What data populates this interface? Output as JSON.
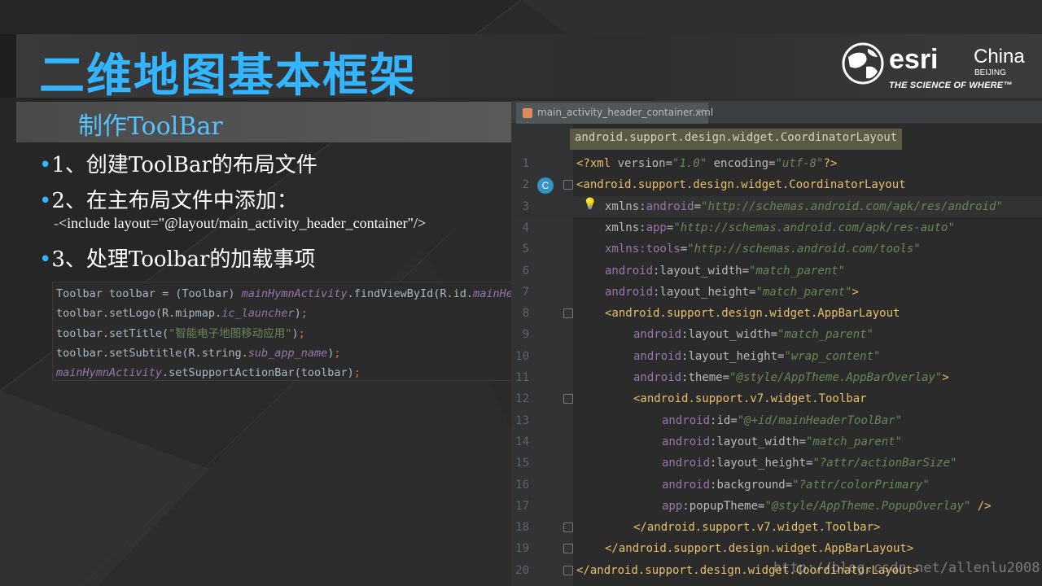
{
  "slide": {
    "title": "二维地图基本框架",
    "subtitle": "制作ToolBar",
    "bullets": [
      {
        "dot": "•",
        "text": "1、创建ToolBar的布局文件"
      },
      {
        "dot": "•",
        "text": "2、在主布局文件中添加："
      },
      {
        "dot": "•",
        "text": "3、处理Toolbar的加载事项"
      }
    ],
    "include_line": {
      "dash": "-",
      "text": "<include layout=\"@layout/main_activity_header_container\"/>"
    }
  },
  "logo": {
    "brand": "esri",
    "region": "China",
    "city": "BEIJING",
    "tagline": "THE SCIENCE OF WHERE™"
  },
  "java_code": [
    [
      {
        "c": "c-id",
        "t": "Toolbar toolbar = (Toolbar) "
      },
      {
        "c": "c-field",
        "t": "mainHymnActivity"
      },
      {
        "c": "c-id",
        "t": ".findViewById(R.id."
      },
      {
        "c": "c-field",
        "t": "mainHeaderToolBar"
      },
      {
        "c": "c-id",
        "t": ")"
      },
      {
        "c": "c-punct",
        "t": ";"
      }
    ],
    [
      {
        "c": "c-id",
        "t": "toolbar.setLogo(R.mipmap."
      },
      {
        "c": "c-field",
        "t": "ic_launcher"
      },
      {
        "c": "c-id",
        "t": ")"
      },
      {
        "c": "c-punct",
        "t": ";"
      }
    ],
    [
      {
        "c": "c-id",
        "t": "toolbar.setTitle("
      },
      {
        "c": "c-str",
        "t": "\"智能电子地图移动应用\""
      },
      {
        "c": "c-id",
        "t": ")"
      },
      {
        "c": "c-punct",
        "t": ";"
      }
    ],
    [
      {
        "c": "c-id",
        "t": "toolbar.setSubtitle(R.string."
      },
      {
        "c": "c-field",
        "t": "sub_app_name"
      },
      {
        "c": "c-id",
        "t": ")"
      },
      {
        "c": "c-punct",
        "t": ";"
      }
    ],
    [
      {
        "c": "c-field",
        "t": "mainHymnActivity"
      },
      {
        "c": "c-id",
        "t": ".setSupportActionBar(toolbar)"
      },
      {
        "c": "c-punct",
        "t": ";"
      }
    ]
  ],
  "editor": {
    "tab_name": "main_activity_header_container.xml",
    "tab_close": "×",
    "breadcrumb": "android.support.design.widget.CoordinatorLayout",
    "gutter_marker": "C",
    "bulb": "💡",
    "lines": [
      {
        "n": "1",
        "indent": 0,
        "parts": [
          {
            "c": "t-tag",
            "t": "<?xml "
          },
          {
            "c": "t-attr",
            "t": "version="
          },
          {
            "c": "t-val",
            "t": "\"1.0\""
          },
          {
            "c": "t-attr",
            "t": " encoding="
          },
          {
            "c": "t-val",
            "t": "\"utf-8\""
          },
          {
            "c": "t-tag",
            "t": "?>"
          }
        ]
      },
      {
        "n": "2",
        "indent": 0,
        "parts": [
          {
            "c": "t-tag",
            "t": "<android.support.design.widget.CoordinatorLayout"
          }
        ]
      },
      {
        "n": "3",
        "indent": 1,
        "parts": [
          {
            "c": "t-attr",
            "t": "xmlns:"
          },
          {
            "c": "t-ns",
            "t": "android"
          },
          {
            "c": "t-attr",
            "t": "="
          },
          {
            "c": "t-val",
            "t": "\"http://schemas.android.com/apk/res/android\""
          }
        ]
      },
      {
        "n": "4",
        "indent": 1,
        "parts": [
          {
            "c": "t-attr",
            "t": "xmlns:"
          },
          {
            "c": "t-ns",
            "t": "app"
          },
          {
            "c": "t-attr",
            "t": "="
          },
          {
            "c": "t-val",
            "t": "\"http://schemas.android.com/apk/res-auto\""
          }
        ]
      },
      {
        "n": "5",
        "indent": 1,
        "parts": [
          {
            "c": "t-ns",
            "t": "xmlns:tools"
          },
          {
            "c": "t-attr",
            "t": "="
          },
          {
            "c": "t-val",
            "t": "\"http://schemas.android.com/tools\""
          }
        ]
      },
      {
        "n": "6",
        "indent": 1,
        "parts": [
          {
            "c": "t-ns",
            "t": "android"
          },
          {
            "c": "t-attr",
            "t": ":layout_width="
          },
          {
            "c": "t-val",
            "t": "\"match_parent\""
          }
        ]
      },
      {
        "n": "7",
        "indent": 1,
        "parts": [
          {
            "c": "t-ns",
            "t": "android"
          },
          {
            "c": "t-attr",
            "t": ":layout_height="
          },
          {
            "c": "t-val",
            "t": "\"match_parent\""
          },
          {
            "c": "t-tag",
            "t": ">"
          }
        ]
      },
      {
        "n": "8",
        "indent": 1,
        "parts": [
          {
            "c": "t-tag",
            "t": "<android.support.design.widget.AppBarLayout"
          }
        ]
      },
      {
        "n": "9",
        "indent": 2,
        "parts": [
          {
            "c": "t-ns",
            "t": "android"
          },
          {
            "c": "t-attr",
            "t": ":layout_width="
          },
          {
            "c": "t-val",
            "t": "\"match_parent\""
          }
        ]
      },
      {
        "n": "10",
        "indent": 2,
        "parts": [
          {
            "c": "t-ns",
            "t": "android"
          },
          {
            "c": "t-attr",
            "t": ":layout_height="
          },
          {
            "c": "t-val",
            "t": "\"wrap_content\""
          }
        ]
      },
      {
        "n": "11",
        "indent": 2,
        "parts": [
          {
            "c": "t-ns",
            "t": "android"
          },
          {
            "c": "t-attr",
            "t": ":theme="
          },
          {
            "c": "t-val",
            "t": "\"@style/AppTheme.AppBarOverlay\""
          },
          {
            "c": "t-tag",
            "t": ">"
          }
        ]
      },
      {
        "n": "12",
        "indent": 2,
        "parts": [
          {
            "c": "t-tag",
            "t": "<android.support.v7.widget.Toolbar"
          }
        ]
      },
      {
        "n": "13",
        "indent": 3,
        "parts": [
          {
            "c": "t-ns",
            "t": "android"
          },
          {
            "c": "t-attr",
            "t": ":id="
          },
          {
            "c": "t-val",
            "t": "\"@+id/mainHeaderToolBar\""
          }
        ]
      },
      {
        "n": "14",
        "indent": 3,
        "parts": [
          {
            "c": "t-ns",
            "t": "android"
          },
          {
            "c": "t-attr",
            "t": ":layout_width="
          },
          {
            "c": "t-val",
            "t": "\"match_parent\""
          }
        ]
      },
      {
        "n": "15",
        "indent": 3,
        "parts": [
          {
            "c": "t-ns",
            "t": "android"
          },
          {
            "c": "t-attr",
            "t": ":layout_height="
          },
          {
            "c": "t-val",
            "t": "\"?attr/actionBarSize\""
          }
        ]
      },
      {
        "n": "16",
        "indent": 3,
        "parts": [
          {
            "c": "t-ns",
            "t": "android"
          },
          {
            "c": "t-attr",
            "t": ":background="
          },
          {
            "c": "t-val",
            "t": "\"?attr/colorPrimary\""
          }
        ]
      },
      {
        "n": "17",
        "indent": 3,
        "parts": [
          {
            "c": "t-ns",
            "t": "app"
          },
          {
            "c": "t-attr",
            "t": ":popupTheme="
          },
          {
            "c": "t-val",
            "t": "\"@style/AppTheme.PopupOverlay\""
          },
          {
            "c": "t-tag",
            "t": " />"
          }
        ]
      },
      {
        "n": "18",
        "indent": 2,
        "parts": [
          {
            "c": "t-tag",
            "t": "</android.support.v7.widget.Toolbar>"
          }
        ]
      },
      {
        "n": "19",
        "indent": 1,
        "parts": [
          {
            "c": "t-tag",
            "t": "</android.support.design.widget.AppBarLayout>"
          }
        ]
      },
      {
        "n": "20",
        "indent": 0,
        "parts": [
          {
            "c": "t-tag",
            "t": "</android.support.design.widget.CoordinatorLayout>"
          }
        ]
      }
    ]
  },
  "watermark": "http://blog.csdn.net/allenlu2008",
  "colors": {
    "title_blue": "#33b5ff",
    "subtitle_blue": "#55c3ff",
    "editor_bg": "#2b2b2b",
    "xml_tag": "#e8bf6a",
    "xml_value": "#6a8759",
    "xml_namespace": "#9876aa"
  }
}
